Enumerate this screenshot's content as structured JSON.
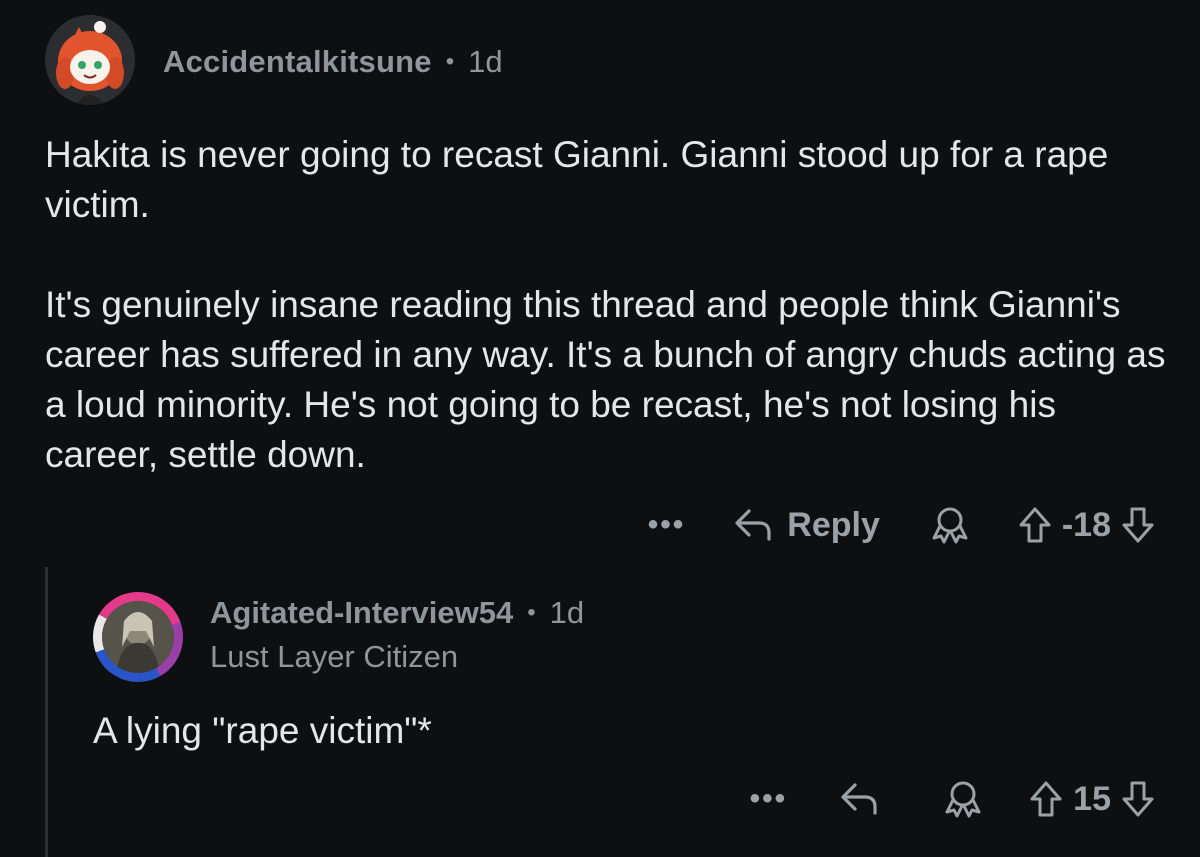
{
  "comment": {
    "username": "Accidentalkitsune",
    "separator": "•",
    "age": "1d",
    "paragraphs": [
      "Hakita is never going to recast Gianni.  Gianni stood up for a rape victim.",
      "It's genuinely insane reading this thread and people think Gianni's career has suffered in any way.  It's a bunch of angry chuds acting as a loud minority.  He's not going to be recast, he's not losing his career, settle down."
    ],
    "actions": {
      "more": "•••",
      "reply_label": "Reply",
      "score": "-18"
    },
    "avatar_icon": "snoo-avatar-icon"
  },
  "reply": {
    "username": "Agitated-Interview54",
    "separator": "•",
    "age": "1d",
    "flair": "Lust Layer Citizen",
    "text": "A lying \"rape victim\"*",
    "actions": {
      "more": "•••",
      "score": "15"
    },
    "avatar_icon": "profile-picture-icon"
  },
  "colors": {
    "background": "#0e0f10",
    "text": "#e4e6e8",
    "meta": "#8e969c",
    "icon": "#9aa2a8",
    "thread_line": "#2c2f33"
  }
}
